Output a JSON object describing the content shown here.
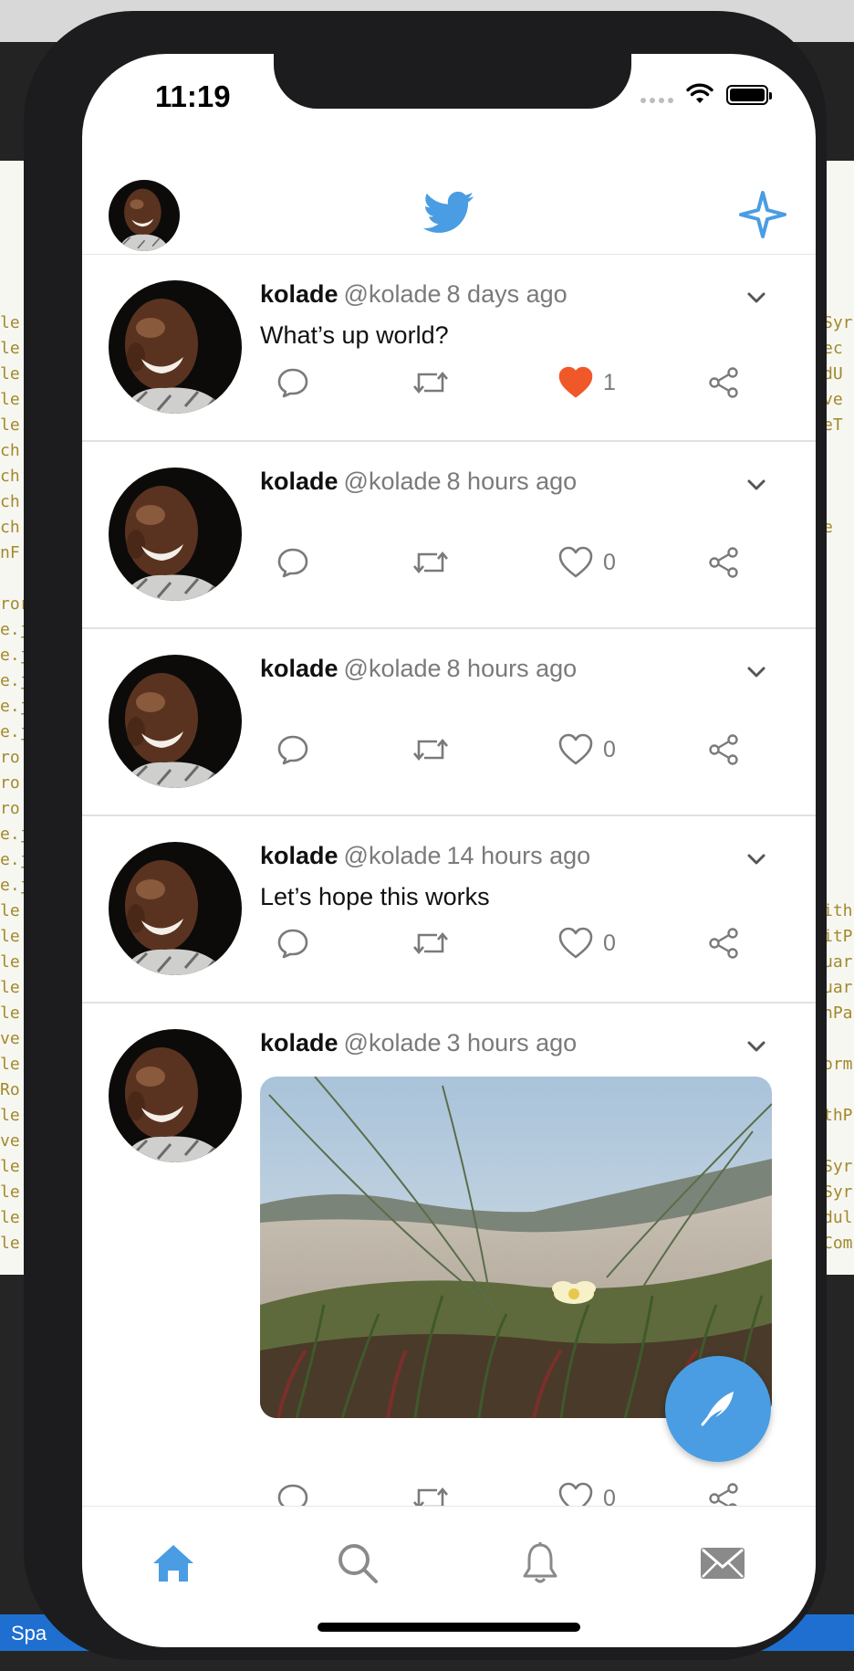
{
  "background": {
    "status_bar_text": "Spa",
    "code_left": [
      "le",
      "le",
      "le",
      "le",
      "le",
      "ch",
      "ch",
      "ch",
      "ch",
      "nF",
      "",
      "ror",
      "e.j",
      "e.j",
      "e.j",
      "e.j",
      "e.j",
      "ro",
      "ro",
      "ro",
      "e.j",
      "e.j",
      "e.j",
      "le",
      "le",
      "le",
      "le",
      "le",
      "ve",
      "le",
      "Ro",
      "le",
      "ve",
      "le",
      "le",
      "le",
      "le"
    ],
    "code_right": [
      "Syr",
      "ec",
      "dU",
      "ve",
      "eT",
      "",
      "",
      "",
      "e",
      "",
      "",
      "",
      "",
      "",
      "",
      "",
      "",
      "",
      "",
      "",
      "",
      "",
      "",
      "ith",
      "itP",
      "uar",
      "uar",
      "nPa",
      "",
      "orm",
      "",
      "thP",
      "",
      "Syr",
      "Syr",
      "dul",
      "Com"
    ]
  },
  "status_bar": {
    "time": "11:19"
  },
  "header": {
    "logo_icon": "twitter-bird-icon",
    "sparkle_icon": "sparkle-icon",
    "accent_color": "#4a9de3"
  },
  "tweets": [
    {
      "name": "kolade",
      "handle": "@kolade",
      "time": "8 days ago",
      "text": "What’s up world?",
      "likes": "1",
      "liked": true,
      "has_image": false
    },
    {
      "name": "kolade",
      "handle": "@kolade",
      "time": "8 hours ago",
      "text": "",
      "likes": "0",
      "liked": false,
      "has_image": false
    },
    {
      "name": "kolade",
      "handle": "@kolade",
      "time": "8 hours ago",
      "text": "",
      "likes": "0",
      "liked": false,
      "has_image": false
    },
    {
      "name": "kolade",
      "handle": "@kolade",
      "time": "14 hours ago",
      "text": "Let’s hope this works",
      "likes": "0",
      "liked": false,
      "has_image": false
    },
    {
      "name": "kolade",
      "handle": "@kolade",
      "time": "3 hours ago",
      "text": "",
      "likes": "0",
      "liked": false,
      "has_image": true
    }
  ],
  "colors": {
    "like_active": "#f0582a",
    "icon_gray": "#7a7a7a",
    "tab_active": "#4a9de3",
    "tab_inactive": "#8a8a8a"
  },
  "tabbar": {
    "items": [
      {
        "icon": "home-icon",
        "active": true
      },
      {
        "icon": "search-icon",
        "active": false
      },
      {
        "icon": "bell-icon",
        "active": false
      },
      {
        "icon": "mail-icon",
        "active": false
      }
    ]
  },
  "fab": {
    "icon": "feather-icon"
  }
}
